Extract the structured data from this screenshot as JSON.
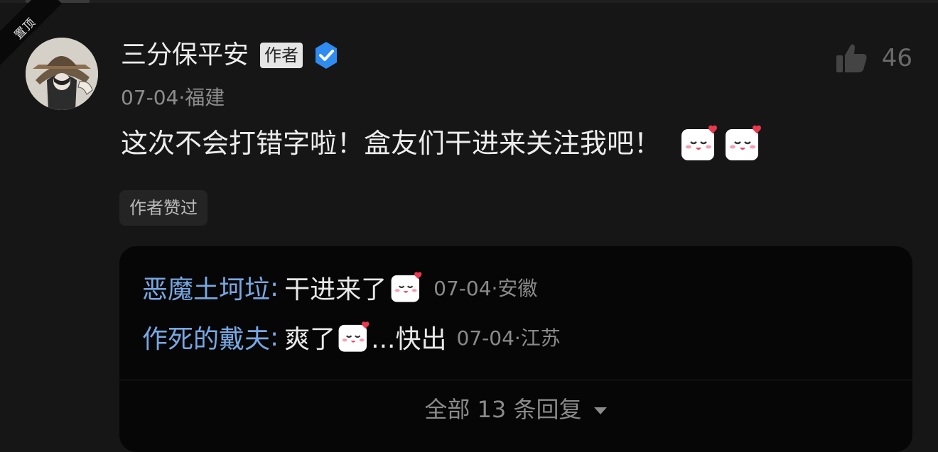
{
  "pin": {
    "label": "置顶"
  },
  "comment": {
    "author": "三分保平安",
    "author_tag": "作者",
    "meta": "07-04·福建",
    "text": "这次不会打错字啦！盒友们干进来关注我吧！",
    "emojis": [
      "blushing-marshmallow-emoji",
      "blushing-marshmallow-emoji"
    ],
    "likes": "46",
    "liked_by_author_label": "作者赞过",
    "verified_icon": "verified-badge-icon",
    "like_icon": "thumbs-up-icon"
  },
  "replies": [
    {
      "name": "恶魔土坷垃",
      "colon": ":",
      "text": "干进来了",
      "after": "",
      "meta": "07-04·安徽"
    },
    {
      "name": "作死的戴夫",
      "colon": ":",
      "text": "爽了",
      "after": "...快出",
      "meta": "07-04·江苏"
    }
  ],
  "more_replies": {
    "label": "全部 13 条回复"
  },
  "colors": {
    "background": "#161616",
    "reply_box": "#060606",
    "reply_name": "#78a8e3",
    "verified": "#2f8cf0"
  }
}
